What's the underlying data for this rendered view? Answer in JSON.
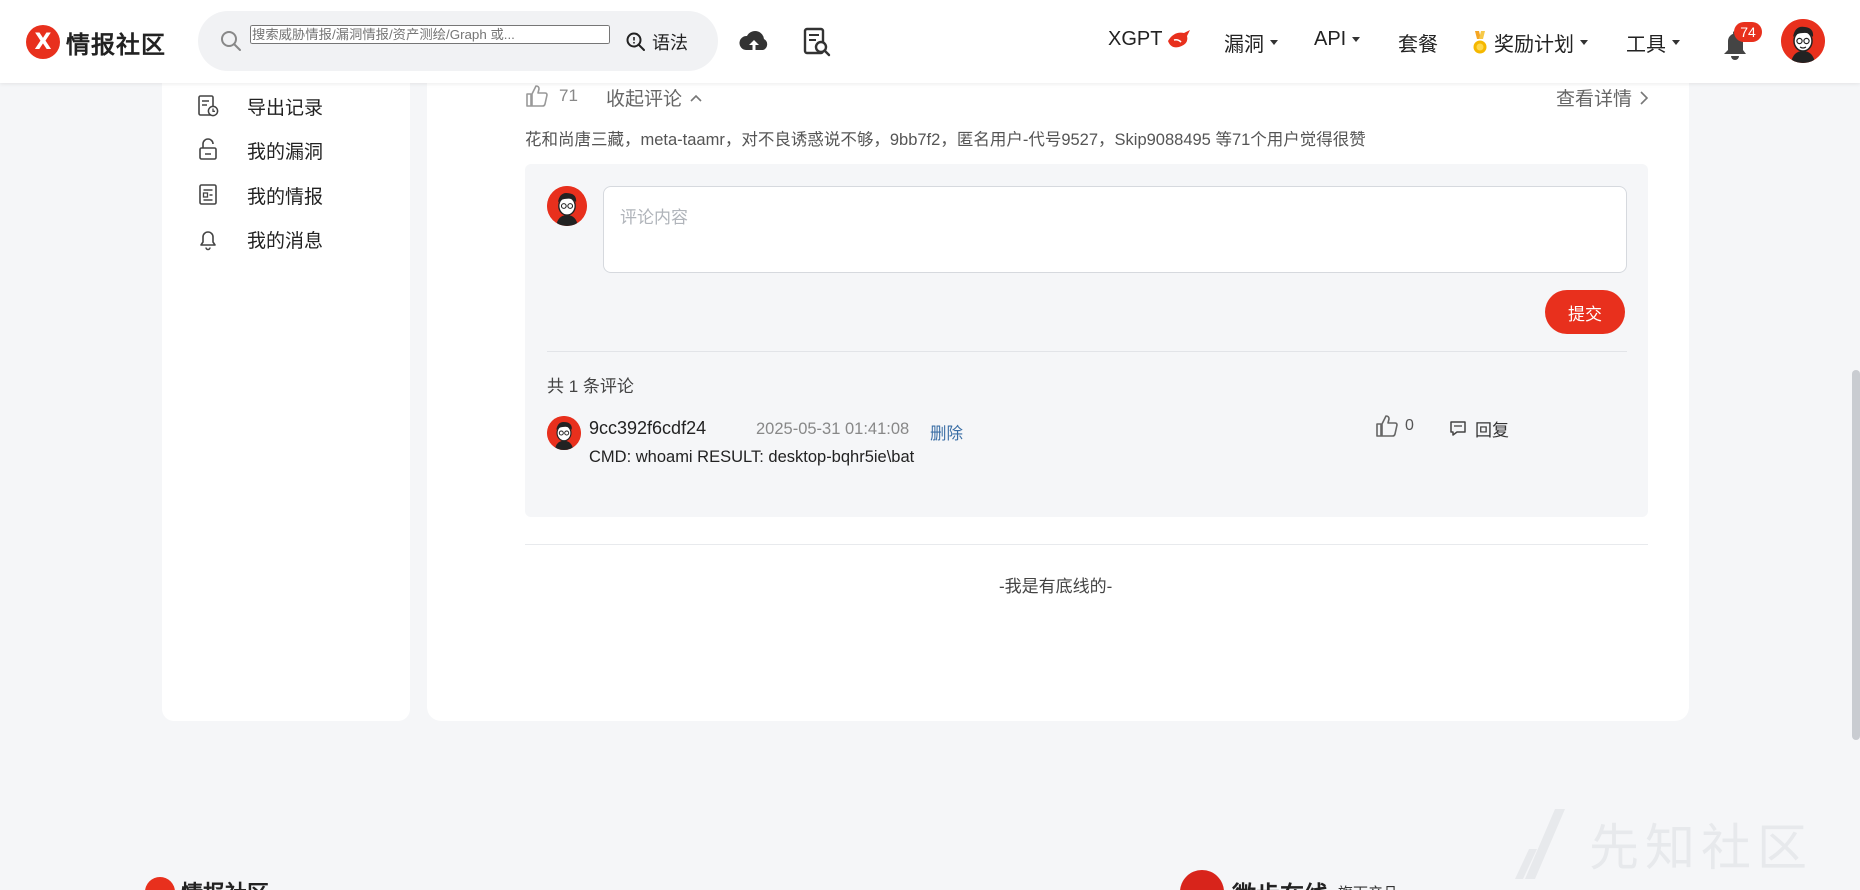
{
  "header": {
    "logo_text": "情报社区",
    "logo_mark": "X",
    "search_placeholder": "搜索威胁情报/漏洞情报/资产测绘/Graph 或...",
    "syntax_label": "语法",
    "nav": {
      "xgpt": "XGPT",
      "vuln": "漏洞",
      "api": "API",
      "plans": "套餐",
      "rewards": "奖励计划",
      "tools": "工具"
    },
    "notification_count": "74"
  },
  "sidebar": {
    "items": [
      {
        "label": "导出记录",
        "icon": "export-record-icon"
      },
      {
        "label": "我的漏洞",
        "icon": "unlock-icon"
      },
      {
        "label": "我的情报",
        "icon": "document-icon"
      },
      {
        "label": "我的消息",
        "icon": "bell-icon"
      }
    ]
  },
  "post": {
    "like_count": "71",
    "collapse_label": "收起评论",
    "details_label": "查看详情",
    "liked_by": "花和尚唐三藏，meta-taamr，对不良诱惑说不够，9bb7f2，匿名用户-代号9527，Skip9088495 等71个用户觉得很赞"
  },
  "comments": {
    "placeholder": "评论内容",
    "submit_label": "提交",
    "total_label": "共 1 条评论",
    "items": [
      {
        "author": "9cc392f6cdf24",
        "time": "2025-05-31 01:41:08",
        "delete_label": "删除",
        "body": "CMD: whoami RESULT: desktop-bqhr5ie\\bat",
        "likes": "0",
        "reply_label": "回复"
      }
    ]
  },
  "end_text": "-我是有底线的-",
  "footer": {
    "logo_text": "情报社区",
    "partner_text": "微步在线",
    "partner_sub": "旗下产品:"
  },
  "watermark_text": "先知社区",
  "colors": {
    "accent": "#e8301d",
    "link": "#3a6ea5",
    "page_bg": "#f5f6f8"
  }
}
